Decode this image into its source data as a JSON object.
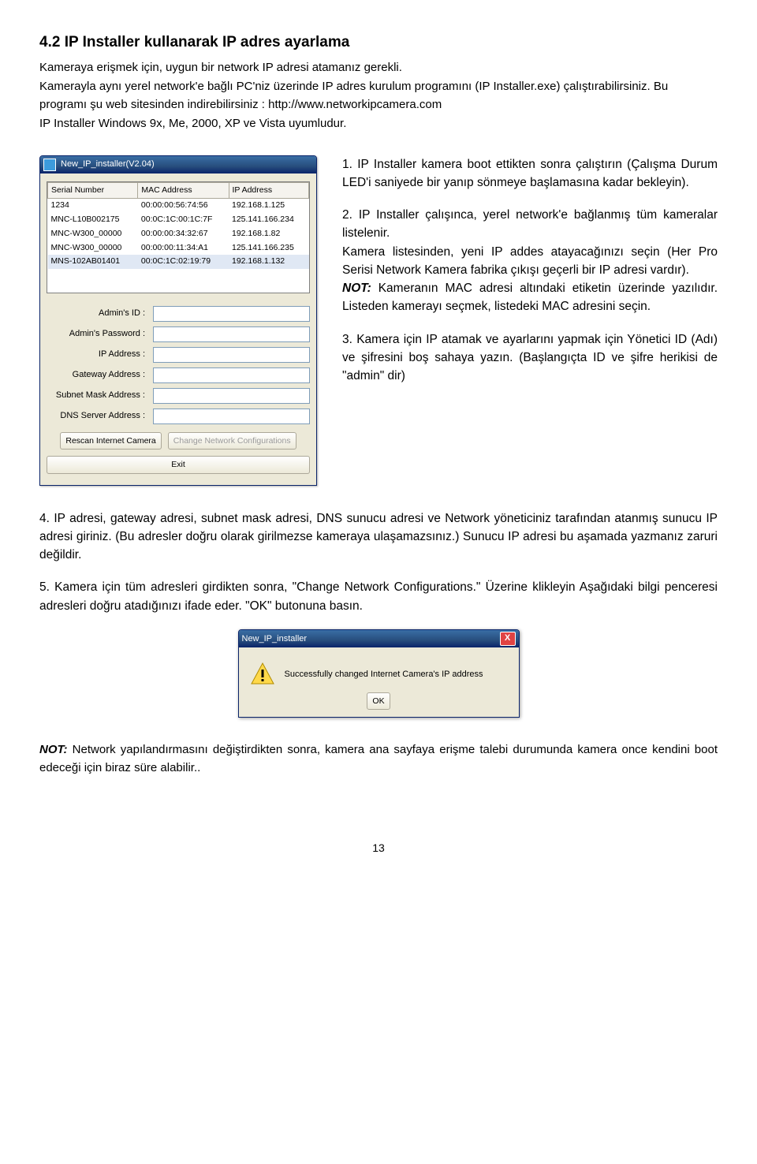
{
  "section": {
    "number": "4.2",
    "title": "IP Installer kullanarak IP adres ayarlama"
  },
  "intro": {
    "p1": "Kameraya erişmek için, uygun bir network IP adresi atamanız gerekli.",
    "p2": "Kamerayla aynı yerel network'e bağlı PC'niz üzerinde IP adres kurulum programını (IP Installer.exe) çalıştırabilirsiniz. Bu programı şu web sitesinden indirebilirsiniz : http://www.networkipcamera.com",
    "p3": "IP Installer Windows 9x, Me, 2000, XP ve Vista uyumludur."
  },
  "installer": {
    "title": "New_IP_installer(V2.04)",
    "cols": {
      "c1": "Serial Number",
      "c2": "MAC Address",
      "c3": "IP Address"
    },
    "rows": [
      {
        "sn": "1234",
        "mac": "00:00:00:56:74:56",
        "ip": "192.168.1.125"
      },
      {
        "sn": "MNC-L10B002175",
        "mac": "00:0C:1C:00:1C:7F",
        "ip": "125.141.166.234"
      },
      {
        "sn": "MNC-W300_00000",
        "mac": "00:00:00:34:32:67",
        "ip": "192.168.1.82"
      },
      {
        "sn": "MNC-W300_00000",
        "mac": "00:00:00:11:34:A1",
        "ip": "125.141.166.235"
      },
      {
        "sn": "MNS-102AB01401",
        "mac": "00:0C:1C:02:19:79",
        "ip": "192.168.1.132"
      }
    ],
    "labels": {
      "admin_id": "Admin's ID :",
      "admin_pw": "Admin's Password :",
      "ip": "IP Address :",
      "gw": "Gateway Address :",
      "mask": "Subnet Mask Address :",
      "dns": "DNS Server Address :"
    },
    "buttons": {
      "rescan": "Rescan Internet Camera",
      "change": "Change Network Configurations",
      "exit": "Exit"
    }
  },
  "right": {
    "p1": "1. IP Installer kamera boot ettikten sonra çalıştırın (Çalışma Durum LED'i saniyede bir yanıp sönmeye başlamasına kadar bekleyin).",
    "p2a": "2. IP Installer çalışınca, yerel network'e bağlanmış tüm kameralar listelenir.",
    "p2b": "Kamera listesinden, yeni IP addes atayacağınızı seçin (Her Pro Serisi Network Kamera fabrika çıkışı geçerli bir IP adresi vardır).",
    "note1_label": "NOT:",
    "p2c": " Kameranın MAC adresi altındaki etiketin üzerinde yazılıdır. Listeden kamerayı seçmek, listedeki MAC adresini seçin.",
    "p3": "3. Kamera için IP atamak ve ayarlarını yapmak için Yönetici ID (Adı) ve şifresini boş sahaya yazın. (Başlangıçta ID ve şifre herikisi de \"admin\" dir)"
  },
  "bottom": {
    "p4": "4. IP adresi, gateway adresi, subnet mask adresi, DNS sunucu adresi ve Network yöneticiniz tarafından atanmış sunucu IP adresi giriniz. (Bu adresler doğru olarak girilmezse kameraya ulaşamazsınız.) Sunucu IP adresi bu aşamada yazmanız zaruri değildir.",
    "p5": "5. Kamera için tüm adresleri girdikten sonra, \"Change Network Configurations.\" Üzerine klikleyin Aşağıdaki bilgi penceresi adresleri doğru atadığınızı ifade eder. \"OK\" butonuna basın."
  },
  "dialog": {
    "title": "New_IP_installer",
    "close": "X",
    "msg": "Successfully changed Internet Camera's IP address",
    "ok": "OK"
  },
  "footer": {
    "label": "NOT:",
    "text": " Network yapılandırmasını değiştirdikten sonra, kamera ana sayfaya erişme talebi durumunda kamera once kendini boot edeceği için biraz süre alabilir.."
  },
  "page": "13"
}
